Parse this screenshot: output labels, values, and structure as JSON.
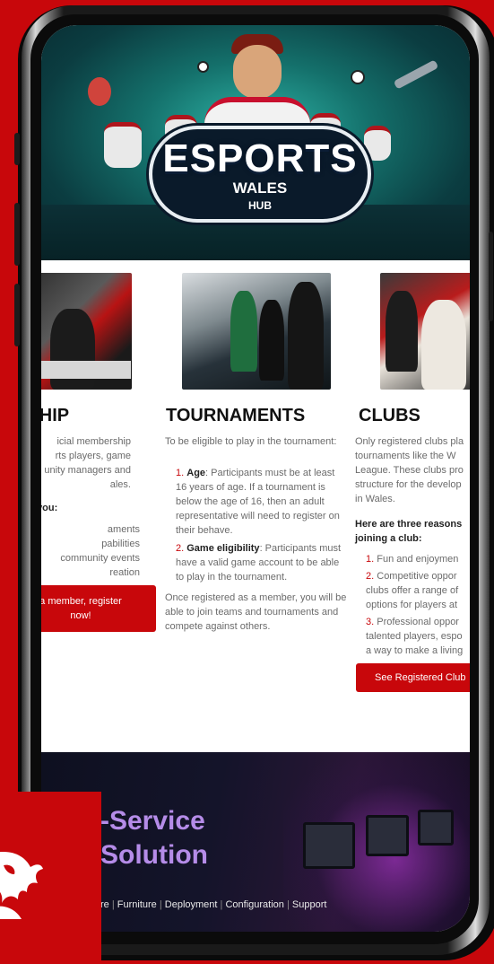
{
  "hero": {
    "logo_title": "ESPORTS",
    "logo_sub1": "WALES",
    "logo_sub2": "HUB"
  },
  "membership": {
    "title": "RSHIP",
    "intro_lines": [
      "icial membership",
      "rts players, game",
      "unity managers and",
      "ales."
    ],
    "benefits_heading": "give you:",
    "benefits": [
      "aments",
      "pabilities",
      "community events",
      "reation"
    ],
    "button_line1": "a member, register",
    "button_line2": "now!"
  },
  "tournaments": {
    "title": "TOURNAMENTS",
    "intro": "To be eligible to play in the tournament:",
    "rule1_num": "1.",
    "rule1_bold": "Age",
    "rule1_text": ": Participants must be at least 16 years of age. If a tournament is below the age of 16, then an adult representative will need to register on their behave.",
    "rule2_num": "2.",
    "rule2_bold": "Game eligibility",
    "rule2_text": ": Participants must have a valid game account to be able to play in the tournament.",
    "after": "Once registered as a member, you will be able to join teams and tournaments and compete against others."
  },
  "clubs": {
    "title": "CLUBS",
    "intro_lines": [
      "Only registered clubs pla",
      "tournaments like the W",
      "League. These clubs pro",
      "structure for the develop",
      "in Wales."
    ],
    "reasons_heading": "Here are three reasons joining a club:",
    "reasons": [
      {
        "num": "1.",
        "lines": [
          "Fun and enjoymen"
        ]
      },
      {
        "num": "2.",
        "lines": [
          "Competitive oppor",
          "clubs offer a range of",
          "options for players at"
        ]
      },
      {
        "num": "3.",
        "lines": [
          "Professional oppor",
          "talented players, espo",
          "a way to make a living"
        ]
      }
    ],
    "button_label": "See Registered Club"
  },
  "promo": {
    "line1": "-Service",
    "line2": "Solution",
    "links": [
      "re",
      "Furniture",
      "Deployment",
      "Configuration",
      "Support"
    ],
    "separator": "|"
  },
  "colors": {
    "brand_red": "#c8070b",
    "promo_purple": "#b58ce8",
    "hero_teal": "#14706b"
  },
  "icons": [
    "dragon-logo-icon"
  ]
}
